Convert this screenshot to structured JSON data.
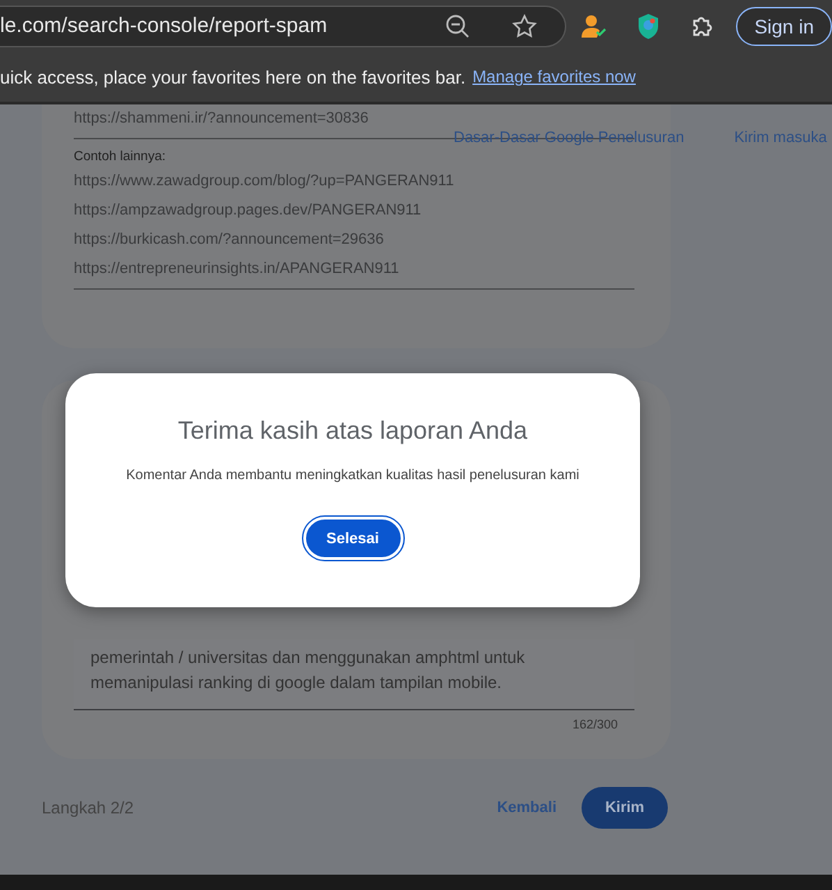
{
  "browser": {
    "address": "le.com/search-console/report-spam",
    "sign_in": "Sign in",
    "favorites_hint": "uick access, place your favorites here on the favorites bar.",
    "favorites_link": "Manage favorites now"
  },
  "nav": [
    "Dasar-Dasar Google Penelusuran",
    "Kirim masuka"
  ],
  "examples_card": {
    "first_url": "https://shammeni.ir/?announcement=30836",
    "heading": "Contoh lainnya:",
    "urls": [
      "https://www.zawadgroup.com/blog/?up=PANGERAN911",
      "https://ampzawadgroup.pages.dev/PANGERAN911",
      "https://burkicash.com/?announcement=29636",
      "https://entrepreneurinsights.in/APANGERAN911"
    ]
  },
  "comment_card": {
    "lines": [
      "pemerintah / universitas dan menggunakan amphtml untuk",
      "memanipulasi ranking di google dalam tampilan mobile."
    ],
    "counter": "162/300"
  },
  "footer": {
    "step": "Langkah 2/2",
    "back": "Kembali",
    "submit": "Kirim"
  },
  "dialog": {
    "title": "Terima kasih atas laporan Anda",
    "message": "Komentar Anda membantu meningkatkan kualitas hasil penelusuran kami",
    "button": "Selesai"
  }
}
